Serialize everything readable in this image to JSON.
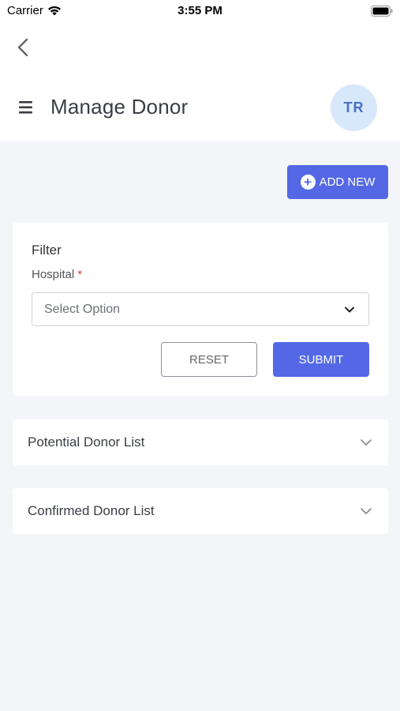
{
  "status_bar": {
    "carrier": "Carrier",
    "time": "3:55 PM"
  },
  "header": {
    "title": "Manage Donor",
    "avatar_initials": "TR",
    "icons": {
      "back": "chevron-left-icon",
      "menu": "hamburger-menu-icon"
    }
  },
  "actions": {
    "add_new_label": "ADD NEW"
  },
  "filter": {
    "title": "Filter",
    "hospital_label": "Hospital",
    "required_marker": "*",
    "select_placeholder": "Select Option",
    "reset_label": "RESET",
    "submit_label": "SUBMIT"
  },
  "sections": [
    {
      "label": "Potential Donor List"
    },
    {
      "label": "Confirmed Donor List"
    }
  ],
  "colors": {
    "primary": "#5468e6",
    "background": "#f4f5f8",
    "avatar_bg": "#d7e8fb",
    "required": "#e53935"
  }
}
